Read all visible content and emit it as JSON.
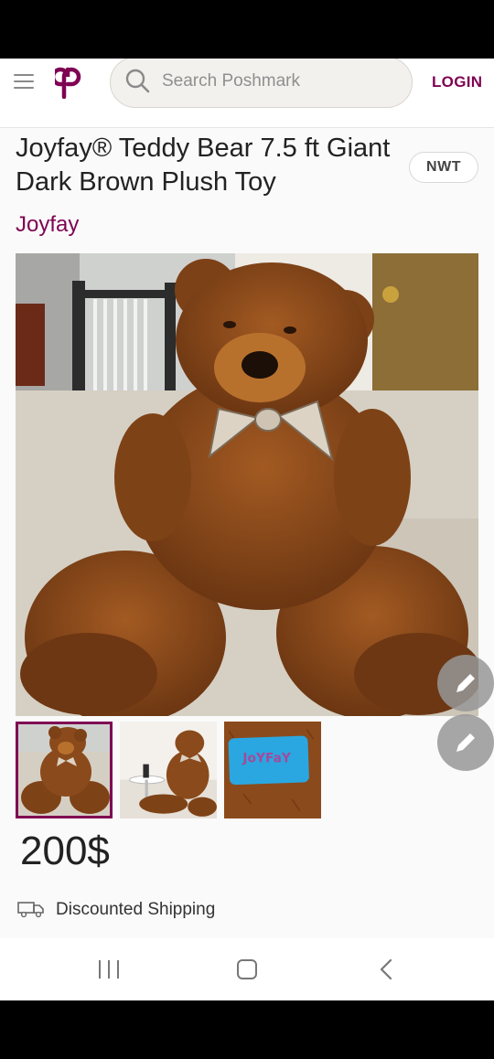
{
  "header": {
    "menu_icon": "hamburger-icon",
    "logo_icon": "poshmark-logo-icon",
    "search_placeholder": "Search Poshmark",
    "login_label": "LOGIN"
  },
  "listing": {
    "title": "Joyfay® Teddy Bear 7.5 ft Giant Dark Brown Plush Toy",
    "condition_badge": "NWT",
    "brand": "Joyfay",
    "thumbnail_brand_tag": "JoYFaY",
    "price": "200$",
    "shipping_label": "Discounted Shipping",
    "selected_thumbnail": 1,
    "thumbnail_count": 3
  },
  "icons": {
    "edit_fab_1": "pencil-icon",
    "edit_fab_2": "pencil-icon",
    "shipping": "truck-icon"
  },
  "colors": {
    "brand_accent": "#7f0353",
    "page_background": "#fafafa"
  },
  "system_nav": {
    "recent_icon": "recent-apps-icon",
    "home_icon": "home-icon",
    "back_icon": "back-icon"
  }
}
